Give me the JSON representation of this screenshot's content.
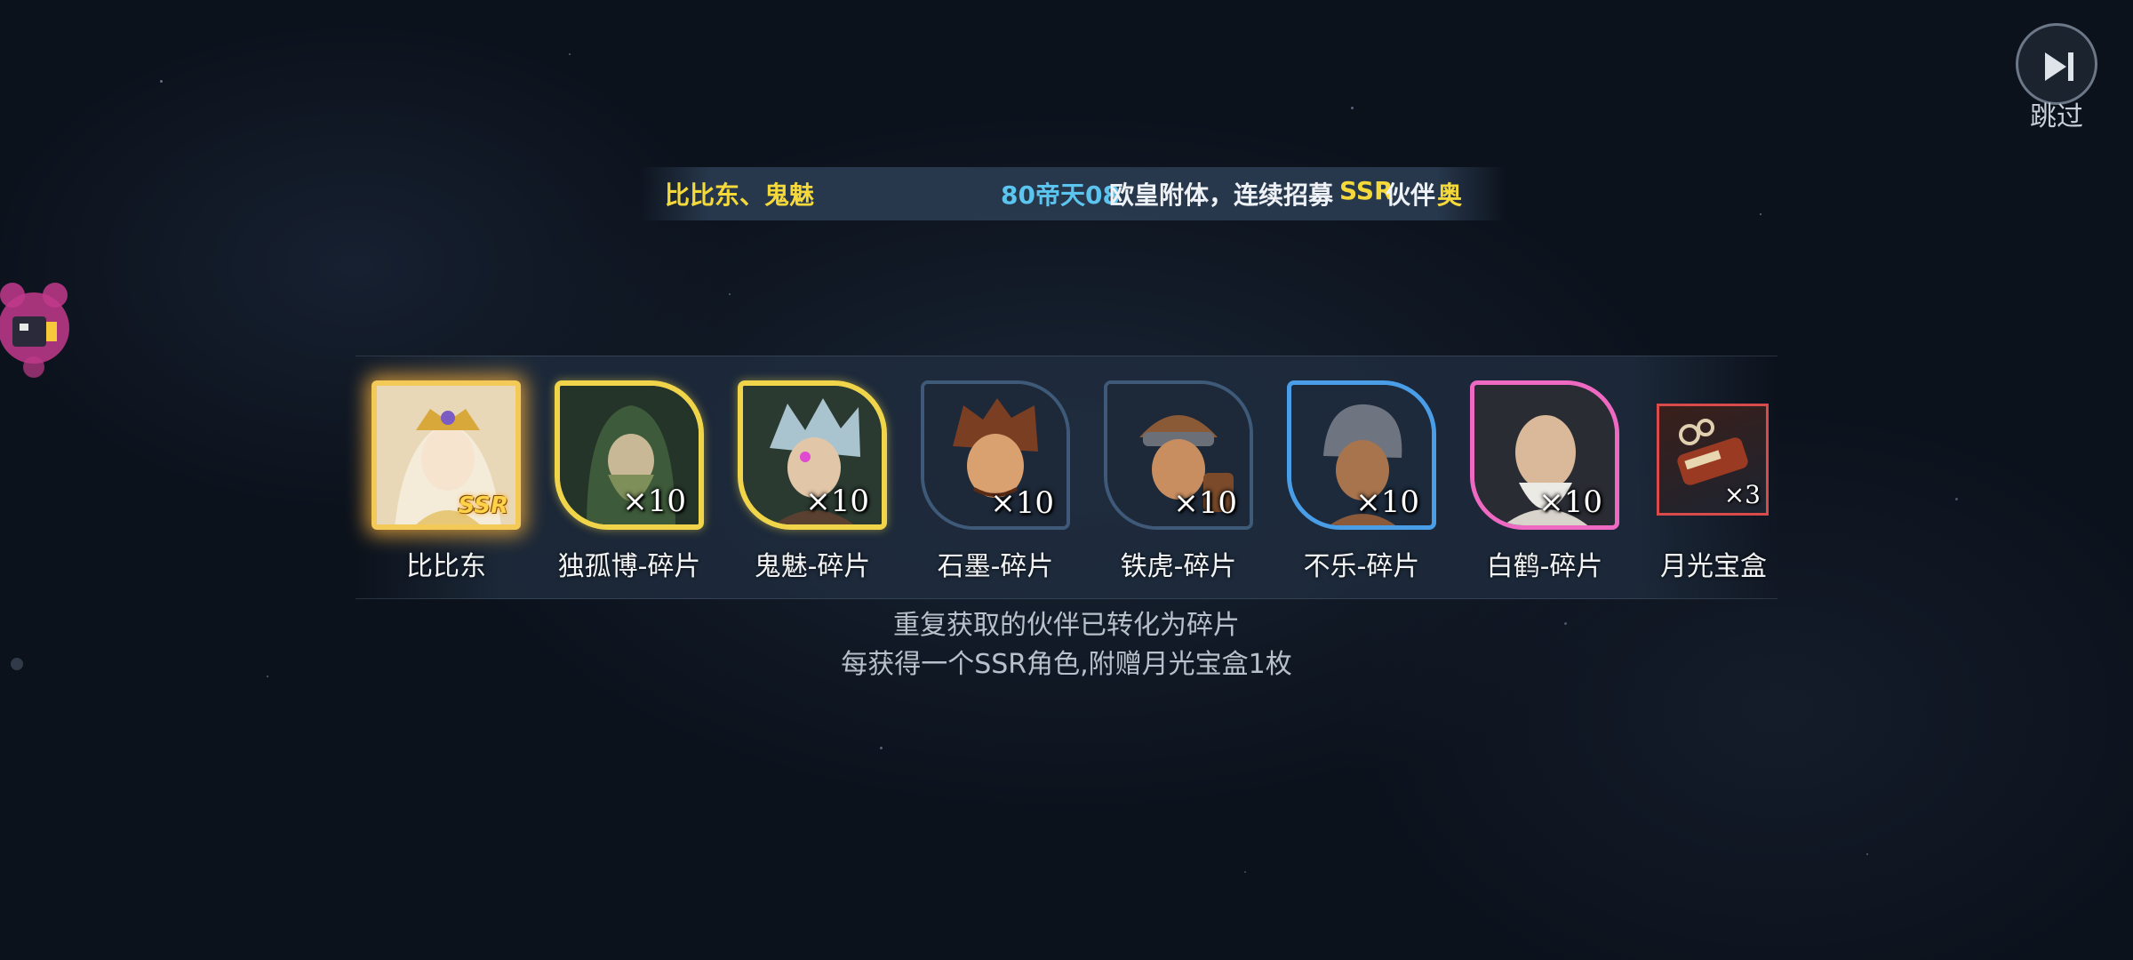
{
  "skip": {
    "label": "跳过"
  },
  "marquee": {
    "segments": [
      {
        "text": "比比东、鬼魅",
        "color": "#f5d93a"
      },
      {
        "text": "80帝天08",
        "color": "#5bc5ef"
      },
      {
        "text": "欧皇附体，连续招募",
        "color": "#eef2f6"
      },
      {
        "text": "SSR",
        "color": "#f5d93a"
      },
      {
        "text": "伙伴",
        "color": "#eef2f6"
      },
      {
        "text": "奥",
        "color": "#f5d93a"
      }
    ]
  },
  "rewards": [
    {
      "name": "比比东",
      "badge": "SSR",
      "frame": "ssr"
    },
    {
      "name": "独孤博-碎片",
      "count": "×10",
      "frame": "gold"
    },
    {
      "name": "鬼魅-碎片",
      "count": "×10",
      "frame": "gold"
    },
    {
      "name": "石墨-碎片",
      "count": "×10",
      "frame": "dark"
    },
    {
      "name": "铁虎-碎片",
      "count": "×10",
      "frame": "dark"
    },
    {
      "name": "不乐-碎片",
      "count": "×10",
      "frame": "blue"
    },
    {
      "name": "白鹤-碎片",
      "count": "×10",
      "frame": "pink"
    },
    {
      "name": "月光宝盒",
      "count": "×3",
      "frame": "item"
    }
  ],
  "notes": {
    "line1": "重复获取的伙伴已转化为碎片",
    "line2": "每获得一个SSR角色,附赠月光宝盒1枚"
  }
}
